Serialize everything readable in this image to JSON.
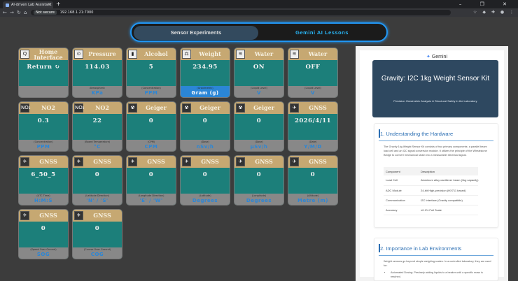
{
  "browser": {
    "tab_title": "AI-driven Lab Assistant",
    "tab_close": "×",
    "new_tab": "+",
    "window_buttons": "– ❐ ✕",
    "not_secure": "Not secure",
    "url": "192.168.1.21:7000"
  },
  "switcher": {
    "tab1": "Sensor Experiments",
    "tab2": "Gemini AI Lessons"
  },
  "cards": [
    {
      "name": "Home\nInterface",
      "value": "Return ↻",
      "sub": "",
      "unit": "",
      "icon": "Q"
    },
    {
      "name": "Pressure",
      "value": "114.03",
      "sub": "Atmospheric",
      "unit": "KPa",
      "icon": "⊙"
    },
    {
      "name": "Alcohol",
      "value": "5",
      "sub": "(Concentration)",
      "unit": "PPM",
      "icon": "▮"
    },
    {
      "name": "Weight",
      "value": "234.95",
      "sub": "(Gravimetric)",
      "unit": "Gram (g)",
      "icon": "⚖"
    },
    {
      "name": "Water",
      "value": "ON",
      "sub": "(Liquid Level)",
      "unit": "V",
      "icon": "≋"
    },
    {
      "name": "Water",
      "value": "OFF",
      "sub": "(Liquid Level)",
      "unit": "V",
      "icon": "≋"
    },
    {
      "name": "NO2",
      "value": "0.3",
      "sub": "(Concentration)",
      "unit": "PPM",
      "icon": "NO₂"
    },
    {
      "name": "NO2",
      "value": "22",
      "sub": "(Board Temperature)",
      "unit": "°C",
      "icon": "NO₂"
    },
    {
      "name": "Geiger",
      "value": "0",
      "sub": "(CPM)",
      "unit": "CPM",
      "icon": "☢"
    },
    {
      "name": "Geiger",
      "value": "0",
      "sub": "(Dose)",
      "unit": "nSv/h",
      "icon": "☢"
    },
    {
      "name": "Geiger",
      "value": "0",
      "sub": "(Dose)",
      "unit": "μSv/h",
      "icon": "☢"
    },
    {
      "name": "GNSS",
      "value": "2026/4/11",
      "sub": "(Date)",
      "unit": "Y/M/D",
      "icon": "✈"
    },
    {
      "name": "GNSS",
      "value": "6_50_5",
      "sub": "(UTC Time)",
      "unit": "H:M:S",
      "icon": "✈"
    },
    {
      "name": "GNSS",
      "value": "0",
      "sub": "(Latitude Direction)",
      "unit": "'N' / 'S'",
      "icon": "✈"
    },
    {
      "name": "GNSS",
      "value": "0",
      "sub": "(Longitude Direction)",
      "unit": "'E' / 'W'",
      "icon": "✈"
    },
    {
      "name": "GNSS",
      "value": "0",
      "sub": "(Latitude)",
      "unit": "Degrees",
      "icon": "✈"
    },
    {
      "name": "GNSS",
      "value": "0",
      "sub": "(Longitude)",
      "unit": "Degrees",
      "icon": "✈"
    },
    {
      "name": "GNSS",
      "value": "0",
      "sub": "(Altitude)",
      "unit": "Metre (m)",
      "icon": "✈"
    },
    {
      "name": "GNSS",
      "value": "0",
      "sub": "(Speed Over Ground)",
      "unit": "SOG",
      "icon": "✈"
    },
    {
      "name": "GNSS",
      "value": "0",
      "sub": "(Course Over Ground)",
      "unit": "COG",
      "icon": "✈"
    }
  ],
  "panel": {
    "brand": "Gemini",
    "title": "Gravity: I2C 1kg Weight Sensor Kit",
    "subtitle": "Precision Gravimetric Analysis & Structural Safety in the Laboratory",
    "sec1_title": "1. Understanding the Hardware",
    "sec1_body": "The Gravity 1kg Weight Sensor Kit consists of two primary components: a parallel beam load cell and an I2C signal conversion module. It utilizes the principle of the Wheatstone Bridge to convert mechanical strain into a measurable electrical signal.",
    "table": {
      "headers": [
        "Component",
        "Description"
      ],
      "rows": [
        [
          "Load Cell",
          "Aluminum alloy cantilever beam (1kg capacity)"
        ],
        [
          "ADC Module",
          "24-bit High-precision (HX711 based)"
        ],
        [
          "Communication",
          "I2C Interface (Gravity compatible)"
        ],
        [
          "Accuracy",
          "±0.1% Full Scale"
        ]
      ]
    },
    "sec2_title": "2. Importance in Lab Environments",
    "sec2_body": "Weight sensors go beyond simple weighing scales. In a controlled laboratory, they are used for:",
    "sec2_bullet": "Automated Dosing: Precisely adding liquids to a beaker until a specific mass is reached."
  }
}
